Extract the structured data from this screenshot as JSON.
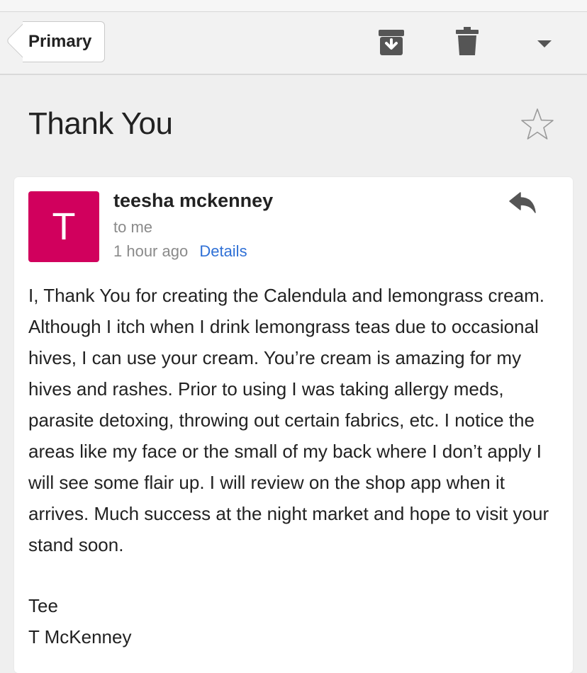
{
  "toolbar": {
    "back_label": "Primary",
    "icons": [
      "archive-icon",
      "trash-icon",
      "caret-down-icon"
    ]
  },
  "message": {
    "subject": "Thank You",
    "star": "star-icon",
    "avatar_letter": "T",
    "avatar_color": "#d1005d",
    "sender": "teesha mckenney",
    "recipient": "to me",
    "time": "1 hour ago",
    "details_link": "Details",
    "body": "I, Thank You for creating the Calendula and lemongrass cream. Although I itch when I drink lemongrass teas due to occasional hives, I can use your cream. You’re cream is amazing for my hives and rashes. Prior to using I was taking allergy meds, parasite detoxing, throwing out certain fabrics, etc. I notice the areas like my face or the small of my back where I don’t apply I will see some flair up. I will review on the shop app when it arrives. Much success at the night market and hope to visit your stand soon.",
    "signature": [
      "Tee",
      "T McKenney"
    ]
  },
  "colors": {
    "link": "#2f70d6",
    "icon": "#555555"
  }
}
